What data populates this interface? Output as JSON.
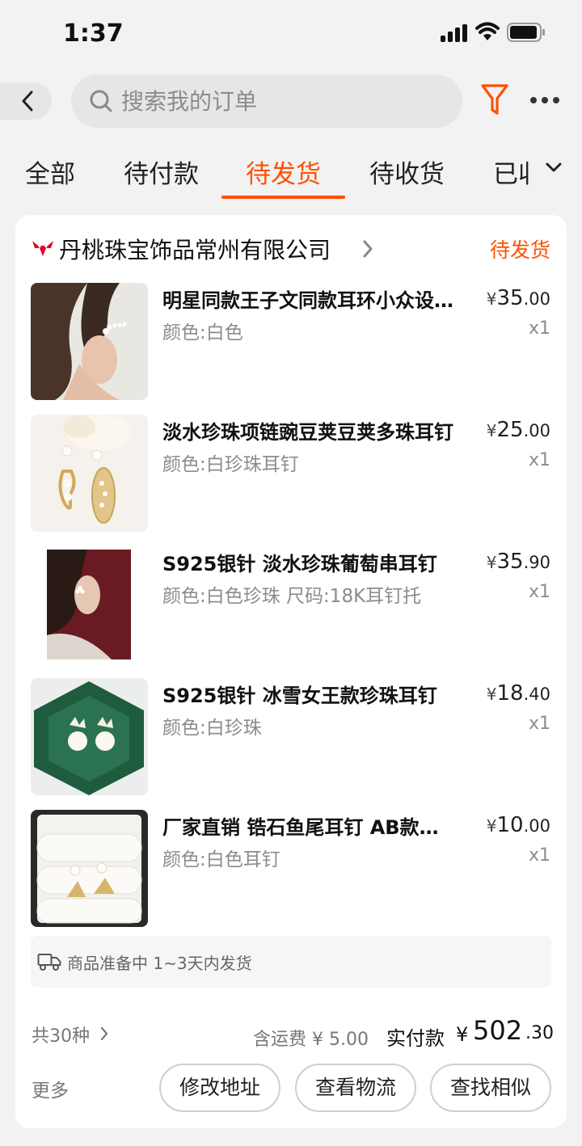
{
  "status_bar": {
    "time": "1:37"
  },
  "search": {
    "placeholder": "搜索我的订单"
  },
  "tabs": [
    {
      "label": "全部"
    },
    {
      "label": "待付款"
    },
    {
      "label": "待发货"
    },
    {
      "label": "待收货"
    },
    {
      "label": "已收货"
    }
  ],
  "active_tab": "待发货",
  "order": {
    "shop_name": "丹桃珠宝饰品常州有限公司",
    "status": "待发货",
    "items": [
      {
        "title": "明星同款王子文同款耳环小众设计感耳钉",
        "spec": "颜色:白色",
        "currency": "¥",
        "price_int": "35",
        "price_dec": ".00",
        "qty": "x1"
      },
      {
        "title": "淡水珍珠项链豌豆荚豆荚多珠耳钉",
        "spec": "颜色:白珍珠耳钉",
        "currency": "¥",
        "price_int": "25",
        "price_dec": ".00",
        "qty": "x1"
      },
      {
        "title": "S925银针 淡水珍珠葡萄串耳钉",
        "spec": "颜色:白色珍珠 尺码:18K耳钉托",
        "currency": "¥",
        "price_int": "35",
        "price_dec": ".90",
        "qty": "x1"
      },
      {
        "title": "S925银针 冰雪女王款珍珠耳钉",
        "spec": "颜色:白珍珠",
        "currency": "¥",
        "price_int": "18",
        "price_dec": ".40",
        "qty": "x1"
      },
      {
        "title": "厂家直销 锆石鱼尾耳钉 AB款耳环",
        "spec": "颜色:白色耳钉",
        "currency": "¥",
        "price_int": "10",
        "price_dec": ".00",
        "qty": "x1"
      }
    ],
    "shipping_notice": "商品准备中 1~3天内发货",
    "item_count": "共30种",
    "shipping_fee": "含运费 ¥ 5.00",
    "paid_label": "实付款",
    "paid_currency": "¥",
    "paid_int": "502",
    "paid_dec": ".30",
    "more_label": "更多",
    "actions": [
      {
        "label": "修改地址"
      },
      {
        "label": "查看物流"
      },
      {
        "label": "查找相似"
      }
    ]
  },
  "colors": {
    "accent": "#ff5000",
    "background": "#f2f2f2"
  }
}
